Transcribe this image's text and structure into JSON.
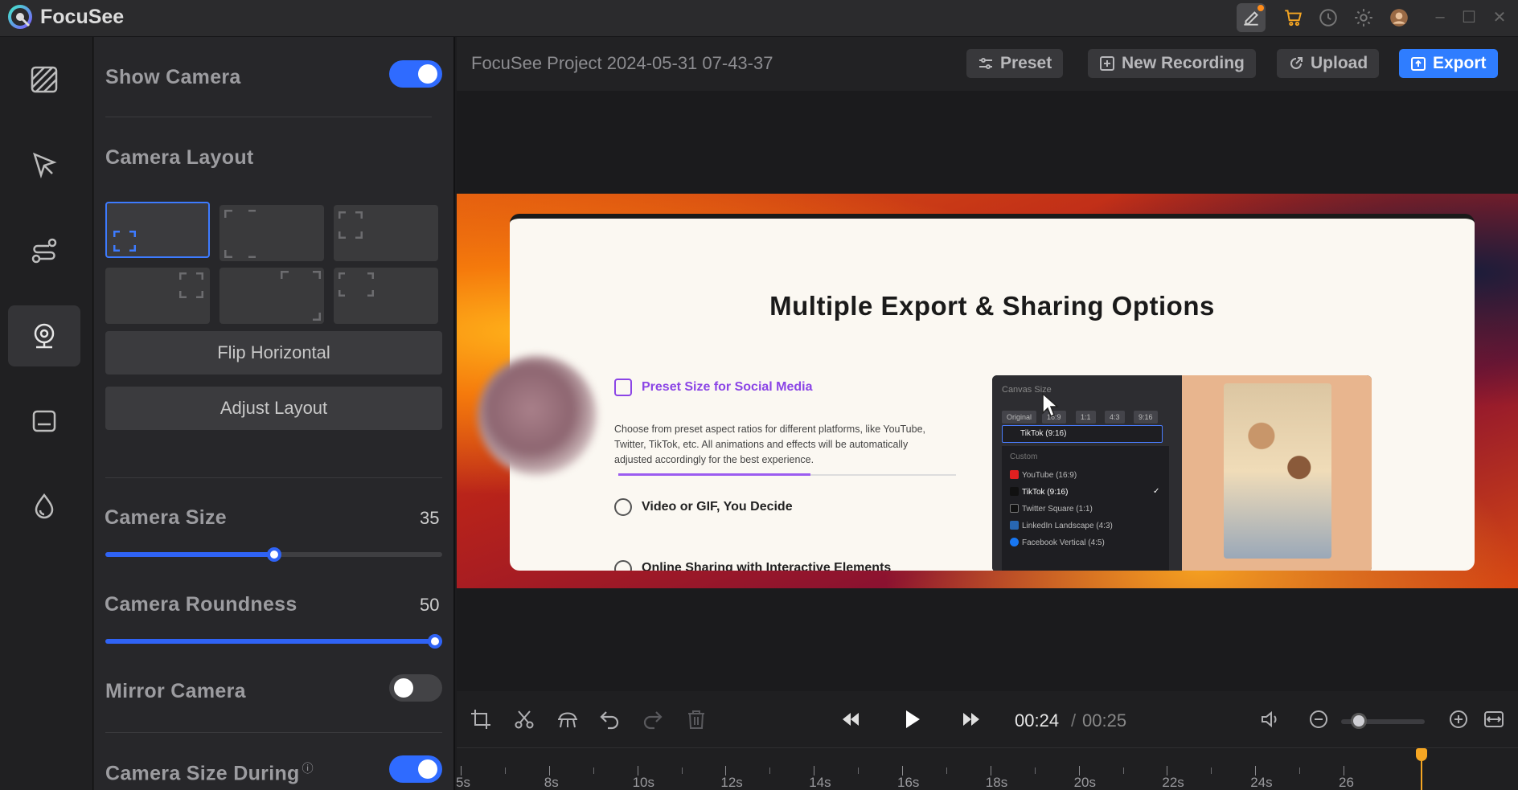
{
  "app": {
    "title": "FocuSee"
  },
  "rail": {
    "items": [
      {
        "name": "background",
        "icon": "pattern-icon"
      },
      {
        "name": "cursor",
        "icon": "cursor-icon"
      },
      {
        "name": "zoom-path",
        "icon": "path-icon"
      },
      {
        "name": "camera",
        "icon": "webcam-icon",
        "active": true
      },
      {
        "name": "captions",
        "icon": "caption-icon"
      },
      {
        "name": "effects",
        "icon": "drop-icon"
      }
    ]
  },
  "panel": {
    "show_camera": {
      "label": "Show Camera",
      "on": true
    },
    "camera_layout": {
      "label": "Camera Layout",
      "selected_index": 0
    },
    "flip_horizontal": "Flip Horizontal",
    "adjust_layout": "Adjust Layout",
    "camera_size": {
      "label": "Camera Size",
      "value": "35",
      "fraction": 0.5
    },
    "camera_roundness": {
      "label": "Camera Roundness",
      "value": "50",
      "fraction": 1.0
    },
    "mirror_camera": {
      "label": "Mirror Camera",
      "on": false
    },
    "camera_size_during": {
      "label": "Camera Size During",
      "info": "ⓘ",
      "on": true
    }
  },
  "topbar": {
    "project_name": "FocuSee Project 2024-05-31 07-43-37",
    "preset": "Preset",
    "new_recording": "New Recording",
    "upload": "Upload",
    "export": "Export"
  },
  "slide": {
    "title": "Multiple Export & Sharing Options",
    "features": [
      {
        "title": "Preset Size for Social Media",
        "active": true
      },
      {
        "title": "Video or GIF, You Decide"
      },
      {
        "title": "Online Sharing with Interactive Elements"
      }
    ],
    "description": "Choose from preset aspect ratios for different platforms, like YouTube, Twitter, TikTok, etc. All animations and effects will be automatically adjusted accordingly for the best experience.",
    "mock": {
      "heading": "Canvas Size",
      "chips": [
        "Original",
        "16:9",
        "1:1",
        "4:3",
        "9:16"
      ],
      "selected": "TikTok (9:16)",
      "custom_label": "Custom",
      "options": [
        "YouTube (16:9)",
        "TikTok (9:16)",
        "Twitter Square (1:1)",
        "LinkedIn Landscape (4:3)",
        "Facebook Vertical (4:5)"
      ],
      "check": "✓"
    }
  },
  "playback": {
    "current_time": "00:24",
    "separator": "/",
    "total_time": "00:25",
    "zoom_fraction": 0.12
  },
  "timeline": {
    "labels": [
      "5s",
      "8s",
      "10s",
      "12s",
      "14s",
      "16s",
      "18s",
      "20s",
      "22s",
      "24s",
      "26"
    ]
  },
  "colors": {
    "accent": "#2f6bff",
    "export": "#2f7dff",
    "highlight": "#8b45e6",
    "playhead": "#f5a623"
  }
}
